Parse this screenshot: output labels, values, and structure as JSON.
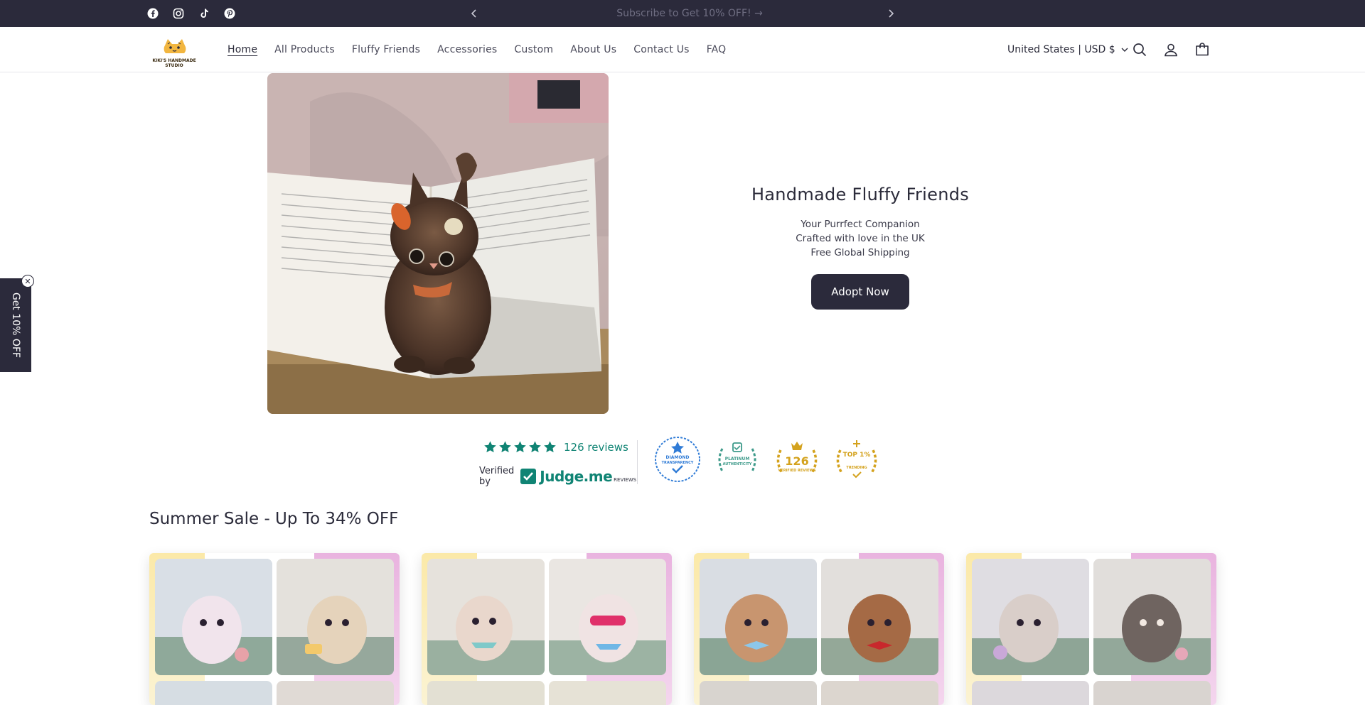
{
  "announcement": {
    "text": "Subscribe to Get 10% OFF! →",
    "social_icons": [
      "facebook-icon",
      "instagram-icon",
      "tiktok-icon",
      "pinterest-icon"
    ]
  },
  "header": {
    "logo_text": "KIKI'S HANDMADE STUDIO",
    "nav": [
      {
        "label": "Home",
        "active": true
      },
      {
        "label": "All Products"
      },
      {
        "label": "Fluffy Friends"
      },
      {
        "label": "Accessories"
      },
      {
        "label": "Custom"
      },
      {
        "label": "About Us"
      },
      {
        "label": "Contact Us"
      },
      {
        "label": "FAQ"
      }
    ],
    "currency": "United States | USD $",
    "icons": [
      "search-icon",
      "account-icon",
      "cart-icon"
    ]
  },
  "hero": {
    "title": "Handmade Fluffy Friends",
    "lines": [
      "Your Purrfect Companion",
      "Crafted with love in the UK",
      "Free Global Shipping"
    ],
    "cta": "Adopt Now"
  },
  "side_tab": {
    "label": "Get 10% OFF",
    "close": "✕"
  },
  "reviews": {
    "rating_stars": 5,
    "count_text": "126 reviews",
    "verified_by": "Verified by",
    "brand": "Judge.me",
    "brand_sub": "REVIEWS",
    "badges": [
      {
        "name": "diamond-transparency-badge",
        "line1": "DIAMOND",
        "line2": "TRANSPARENCY",
        "color": "#2f7bd6"
      },
      {
        "name": "platinum-authenticity-badge",
        "line1": "PLATINUM",
        "line2": "AUTHENTICITY",
        "color": "#3d9a8a"
      },
      {
        "name": "verified-reviews-badge",
        "line1": "126",
        "line2": "VERIFIED REVIEWS",
        "color": "#d4a21d"
      },
      {
        "name": "top-trending-badge",
        "line1": "TOP 1%",
        "line2": "TRENDING",
        "color": "#d4a21d"
      }
    ]
  },
  "section": {
    "title": "Summer Sale - Up To 34% OFF",
    "cards": [
      {
        "name": "product-card-1",
        "tone_a": "#f4e6ea",
        "tone_b": "#e8dbc8"
      },
      {
        "name": "product-card-2",
        "tone_a": "#eadfd7",
        "tone_b": "#f1e0e6"
      },
      {
        "name": "product-card-3",
        "tone_a": "#d7b39a",
        "tone_b": "#b98566"
      },
      {
        "name": "product-card-4",
        "tone_a": "#e6ddd8",
        "tone_b": "#8a7e78"
      }
    ]
  },
  "colors": {
    "dark": "#2b2a3b",
    "accent_green": "#108474"
  }
}
